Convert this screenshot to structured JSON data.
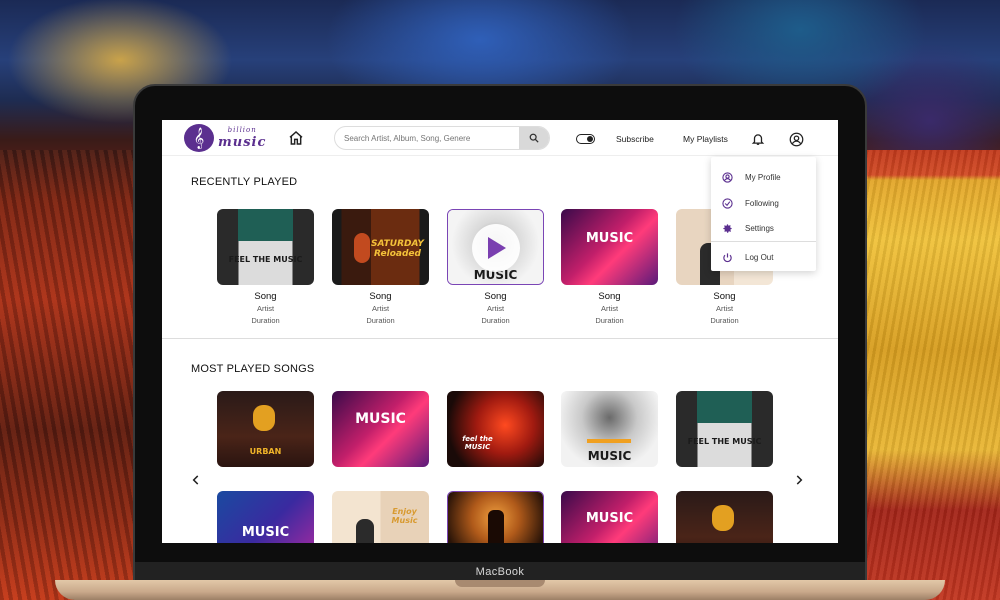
{
  "device": {
    "label": "MacBook"
  },
  "logo": {
    "small": "billion",
    "big": "music"
  },
  "search": {
    "placeholder": "Search Artist, Album, Song, Genere"
  },
  "nav": {
    "subscribe": "Subscribe",
    "playlists": "My Playlists"
  },
  "dropdown": {
    "items": [
      {
        "label": "My Profile",
        "icon": "user-circle-icon"
      },
      {
        "label": "Following",
        "icon": "check-circle-icon"
      },
      {
        "label": "Settings",
        "icon": "gear-icon"
      },
      {
        "label": "Log Out",
        "icon": "power-icon"
      }
    ]
  },
  "recent": {
    "title": "RECENTLY PLAYED",
    "cards": [
      {
        "song": "Song",
        "artist": "Artist",
        "duration": "Duration",
        "art_text": "FEEL THE MUSIC"
      },
      {
        "song": "Song",
        "artist": "Artist",
        "duration": "Duration",
        "art_text": "SATURDAY Reloaded"
      },
      {
        "song": "Song",
        "artist": "Artist",
        "duration": "Duration",
        "art_text": "MUSIC",
        "playing": true
      },
      {
        "song": "Song",
        "artist": "Artist",
        "duration": "Duration",
        "art_text": "MUSIC"
      },
      {
        "song": "Song",
        "artist": "Artist",
        "duration": "Duration",
        "art_text": ""
      }
    ]
  },
  "most": {
    "title": "MOST PLAYED SONGS",
    "row1": [
      "URBAN",
      "MUSIC",
      "feel the MUSIC",
      "MUSIC",
      "FEEL THE MUSIC"
    ],
    "row2": [
      "MUSIC",
      "Enjoy Music",
      "",
      "MUSIC",
      ""
    ]
  },
  "colors": {
    "accent": "#5b2f8f",
    "active_border": "#7a45b5"
  }
}
